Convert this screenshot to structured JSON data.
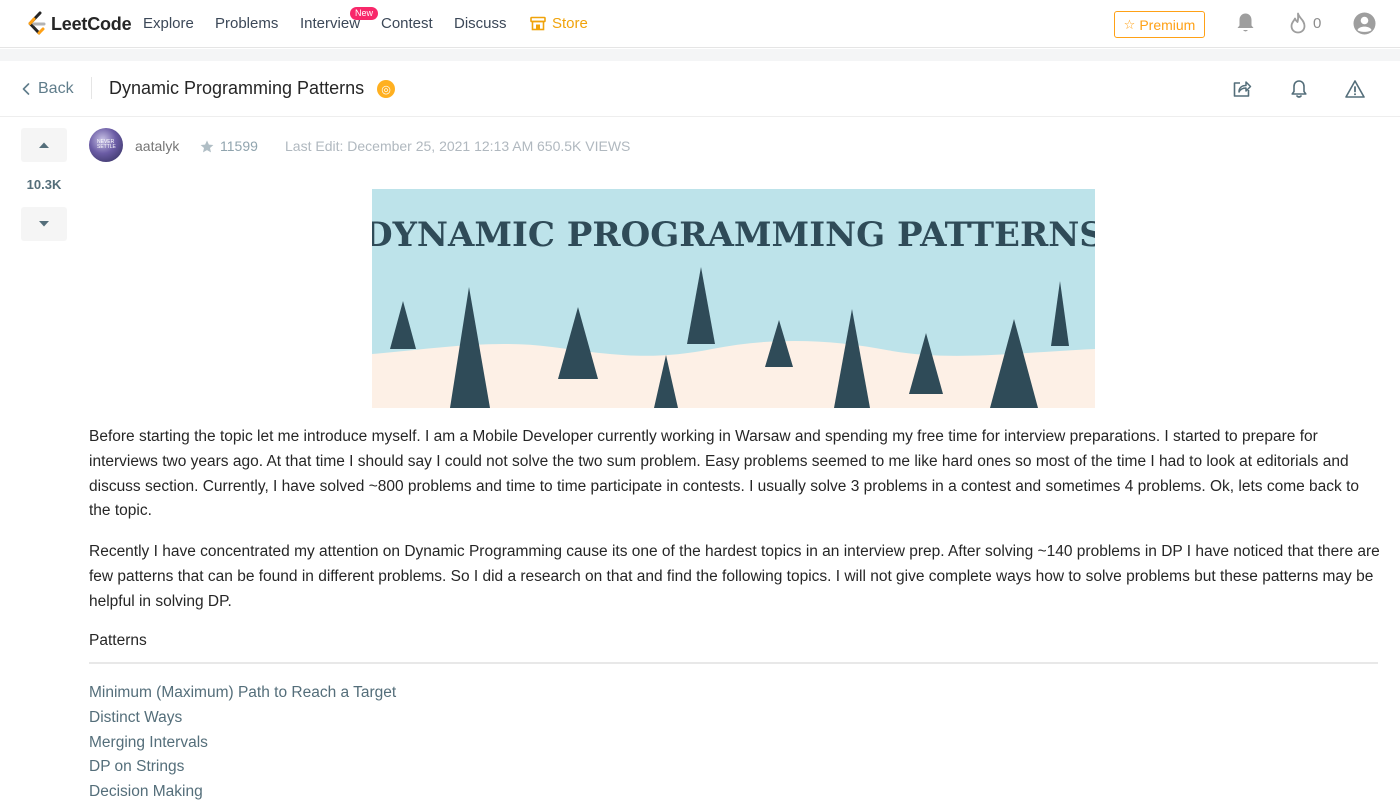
{
  "nav": {
    "brand": "LeetCode",
    "items": [
      "Explore",
      "Problems",
      "Interview",
      "Contest",
      "Discuss"
    ],
    "badge": "New",
    "store": "Store",
    "premium": "Premium",
    "streak_count": "0"
  },
  "header": {
    "back_label": "Back",
    "title": "Dynamic Programming Patterns"
  },
  "vote": {
    "count": "10.3K"
  },
  "meta": {
    "username": "aatalyk",
    "reputation": "11599",
    "last_edit": "Last Edit: December 25, 2021 12:13 AM",
    "views": "650.5K VIEWS",
    "avatar_text": "NEVER SETTLE"
  },
  "banner": {
    "title": "DYNAMIC PROGRAMMING PATTERNS",
    "colors": {
      "sky": "#bde3ea",
      "snow": "#fdf0e6",
      "trees": "#2f4b58",
      "title": "#2f4b58"
    }
  },
  "content": {
    "paragraphs": [
      "Before starting the topic let me introduce myself. I am a Mobile Developer currently working in Warsaw and spending my free time for interview preparations. I started to prepare for interviews two years ago. At that time I should say I could not solve the two sum problem. Easy problems seemed to me like hard ones so most of the time I had to look at editorials and discuss section. Currently, I have solved ~800 problems and time to time participate in contests. I usually solve 3 problems in a contest and sometimes 4 problems. Ok, lets come back to the topic.",
      "Recently I have concentrated my attention on Dynamic Programming cause its one of the hardest topics in an interview prep. After solving ~140 problems in DP I have noticed that there are few patterns that can be found in different problems. So I did a research on that and find the following topics. I will not give complete ways how to solve problems but these patterns may be helpful in solving DP."
    ],
    "patterns_heading": "Patterns",
    "pattern_links": [
      "Minimum (Maximum) Path to Reach a Target",
      "Distinct Ways",
      "Merging Intervals",
      "DP on Strings",
      "Decision Making"
    ]
  },
  "colors": {
    "accent": "#ffa116",
    "store": "#f0a30b",
    "link": "#546e7a",
    "badge": "#f8286a"
  }
}
